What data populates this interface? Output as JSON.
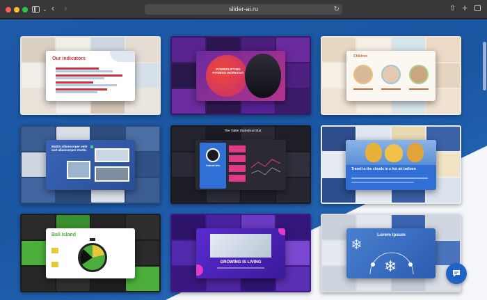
{
  "browser": {
    "url": "slider-ai.ru",
    "nav": {
      "back_icon": "chevron-left-icon",
      "forward_icon": "chevron-right-icon"
    }
  },
  "colors": {
    "page_blue": "#1e5aa8",
    "accent_red": "#c8333a",
    "pink": "#e23a86",
    "green": "#4caf3c",
    "chat_blue": "#1f63c6"
  },
  "templates": [
    {
      "id": "t1",
      "title": "Our indicators"
    },
    {
      "id": "t2",
      "title": "POWERLIFTING FITNESS WORKOUT"
    },
    {
      "id": "t3",
      "title": "Children"
    },
    {
      "id": "t4",
      "title": "Mattis ullamcorper velit sed ullamcorper morbi."
    },
    {
      "id": "t5",
      "title": "The Table Statistical Stat",
      "name": "Yolanda Weu"
    },
    {
      "id": "t6",
      "title": "Travel to the clouds in a hot air balloon"
    },
    {
      "id": "t7",
      "title": "Bali Island"
    },
    {
      "id": "t8",
      "title": "GROWING IS LIVING"
    },
    {
      "id": "t9",
      "title": "Lorem ipsum"
    }
  ]
}
